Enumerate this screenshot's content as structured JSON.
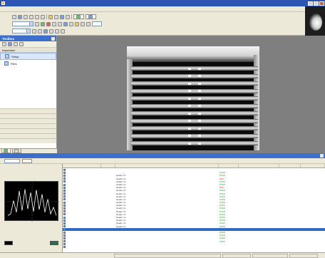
{
  "window": {
    "title": ""
  },
  "menu": {
    "items": [
      "",
      "",
      "",
      "",
      "",
      "",
      "",
      ""
    ]
  },
  "toolbar": {
    "rows": [
      {
        "label": "",
        "combo_value": "",
        "button_labels": [
          "",
          ""
        ]
      },
      {
        "label": "",
        "combo_value": "",
        "field_value": ""
      },
      {
        "label": "",
        "combo_value": ""
      }
    ]
  },
  "toolbox": {
    "title": "Toolbox",
    "section": "Inspection",
    "items": [
      {
        "label": "Setup",
        "selected": true
      },
      {
        "label": "Files",
        "selected": false
      }
    ],
    "categories": [
      "",
      "",
      "",
      "",
      "",
      "",
      ""
    ],
    "tabs": [
      "",
      ""
    ]
  },
  "results": {
    "title": "",
    "toolbar_label": "",
    "columns": [
      "",
      "",
      "",
      "",
      "",
      "",
      ""
    ],
    "rows": [
      {
        "name": "",
        "method": "",
        "output": "",
        "result": "",
        "cause": "",
        "count": "",
        "extra": ""
      },
      {
        "name": "",
        "method": "",
        "output": "",
        "result": "PASS",
        "cause": "",
        "count": "",
        "extra": ""
      },
      {
        "name": "",
        "method": "",
        "output": "Count = 4",
        "result": "PASS",
        "cause": "",
        "count": "",
        "extra": ""
      },
      {
        "name": "",
        "method": "",
        "output": "Count = 4",
        "result": "FAIL",
        "cause": "",
        "count": "",
        "extra": ""
      },
      {
        "name": "",
        "method": "",
        "output": "Count = 4",
        "result": "PASS",
        "cause": "",
        "count": "",
        "extra": ""
      },
      {
        "name": "",
        "method": "",
        "output": "Count = 4",
        "result": "PASS",
        "cause": "",
        "count": "",
        "extra": ""
      },
      {
        "name": "",
        "method": "",
        "output": "Count = 4",
        "result": "FAIL",
        "cause": "",
        "count": "",
        "extra": ""
      },
      {
        "name": "",
        "method": "",
        "output": "Count = 4",
        "result": "PASS",
        "cause": "",
        "count": "",
        "extra": ""
      },
      {
        "name": "",
        "method": "",
        "output": "Count = 4",
        "result": "PASS",
        "cause": "",
        "count": "",
        "extra": ""
      },
      {
        "name": "",
        "method": "",
        "output": "Count = 4",
        "result": "PASS",
        "cause": "",
        "count": "",
        "extra": ""
      },
      {
        "name": "",
        "method": "",
        "output": "Count = 4",
        "result": "PASS",
        "cause": "",
        "count": "",
        "extra": ""
      },
      {
        "name": "",
        "method": "",
        "output": "Count = 4",
        "result": "PASS",
        "cause": "",
        "count": "",
        "extra": ""
      },
      {
        "name": "",
        "method": "",
        "output": "Count = 4",
        "result": "PASS",
        "cause": "",
        "count": "",
        "extra": ""
      },
      {
        "name": "",
        "method": "",
        "output": "Count = 4",
        "result": "PASS",
        "cause": "",
        "count": "",
        "extra": ""
      },
      {
        "name": "",
        "method": "",
        "output": "Count = 4",
        "result": "PASS",
        "cause": "",
        "count": "",
        "extra": ""
      },
      {
        "name": "",
        "method": "",
        "output": "Count = 4",
        "result": "PASS",
        "cause": "",
        "count": "",
        "extra": ""
      },
      {
        "name": "",
        "method": "",
        "output": "Count = 4",
        "result": "PASS",
        "cause": "",
        "count": "",
        "extra": ""
      },
      {
        "name": "",
        "method": "",
        "output": "Count = 4",
        "result": "PASS",
        "cause": "",
        "count": "",
        "extra": ""
      },
      {
        "name": "",
        "method": "",
        "output": "Count = 4",
        "result": "PASS",
        "cause": "",
        "count": "",
        "extra": ""
      },
      {
        "name": "",
        "method": "",
        "output": "Count = 4",
        "result": "PASS",
        "cause": "",
        "count": "",
        "extra": ""
      },
      {
        "name": "",
        "method": "",
        "output": "",
        "result": "",
        "cause": "",
        "count": "",
        "extra": "",
        "selected": true
      },
      {
        "name": "",
        "method": "",
        "output": "",
        "result": "PASS",
        "cause": "",
        "count": "",
        "extra": ""
      },
      {
        "name": "",
        "method": "",
        "output": "",
        "result": "PASS",
        "cause": "",
        "count": "",
        "extra": ""
      },
      {
        "name": "",
        "method": "",
        "output": "",
        "result": "PASS",
        "cause": "",
        "count": "",
        "extra": ""
      },
      {
        "name": "",
        "method": "",
        "output": "",
        "result": "PASS",
        "cause": "",
        "count": "",
        "extra": ""
      },
      {
        "name": "",
        "method": "",
        "output": "",
        "result": "",
        "cause": "",
        "count": "",
        "extra": ""
      },
      {
        "name": "",
        "method": "",
        "output": "",
        "result": "",
        "cause": "",
        "count": "",
        "extra": ""
      }
    ]
  },
  "graph": {
    "profile": [
      0.1,
      0.15,
      0.55,
      0.2,
      0.85,
      0.25,
      0.9,
      0.3,
      0.8,
      0.22,
      0.88,
      0.28,
      0.75,
      0.2,
      0.6,
      0.15,
      0.35,
      0.1
    ]
  },
  "status": {
    "cells": [
      "",
      "",
      "",
      ""
    ]
  },
  "colors": {
    "accent": "#3c6fcb",
    "pass": "#2e9a2e",
    "fail": "#d03030",
    "selection": "#316ac5"
  }
}
